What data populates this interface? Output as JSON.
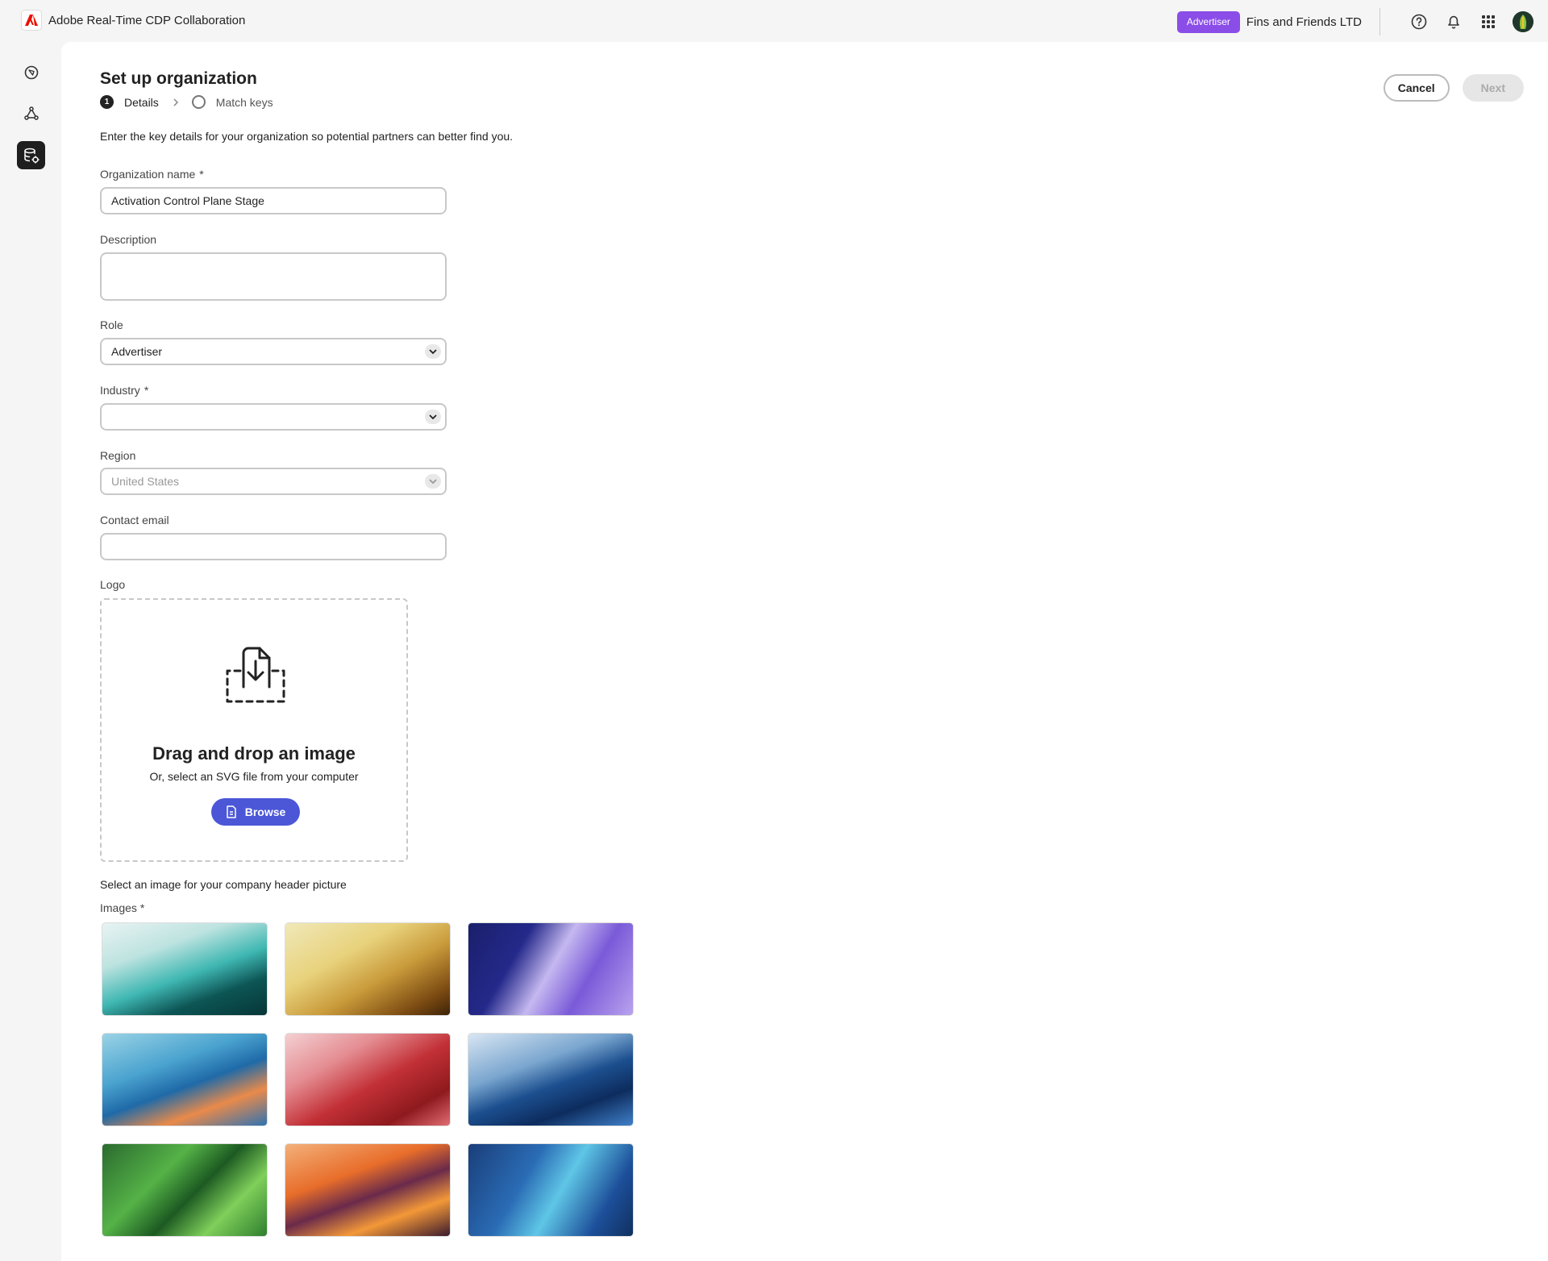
{
  "app": {
    "title": "Adobe Real-Time CDP Collaboration",
    "role_badge": "Advertiser",
    "org_name": "Fins and Friends LTD",
    "badge_color": "#8a4de8"
  },
  "icons": {
    "top": [
      "help-icon",
      "bell-icon",
      "apps-grid-icon",
      "avatar"
    ],
    "rail": [
      "discover-icon",
      "connections-icon",
      "database-settings-icon"
    ]
  },
  "page": {
    "title": "Set up organization",
    "steps": [
      {
        "number": "1",
        "label": "Details",
        "active": true
      },
      {
        "label": "Match keys",
        "active": false
      }
    ],
    "cancel_label": "Cancel",
    "next_label": "Next",
    "intro": "Enter the key details for your organization so potential partners can better find you."
  },
  "form": {
    "org_name_label": "Organization name",
    "org_name_value": "Activation Control Plane Stage",
    "required_mark": "*",
    "description_label": "Description",
    "description_value": "",
    "role_label": "Role",
    "role_value": "Advertiser",
    "industry_label": "Industry",
    "industry_value": "",
    "region_label": "Region",
    "region_value": "United States",
    "email_label": "Contact email",
    "email_value": "",
    "logo_label": "Logo"
  },
  "dropzone": {
    "title": "Drag and drop an image",
    "subtitle": "Or, select an SVG file from your computer",
    "browse_label": "Browse",
    "button_color": "#4b57d6"
  },
  "images": {
    "prompt": "Select an image for your company header picture",
    "label": "Images",
    "thumbnails": [
      "teal-wave",
      "gold-wave",
      "purple-wave",
      "blue-orange-wave",
      "red-wave",
      "navy-wave",
      "green-geometric",
      "orange-wave",
      "blue-lines"
    ]
  }
}
